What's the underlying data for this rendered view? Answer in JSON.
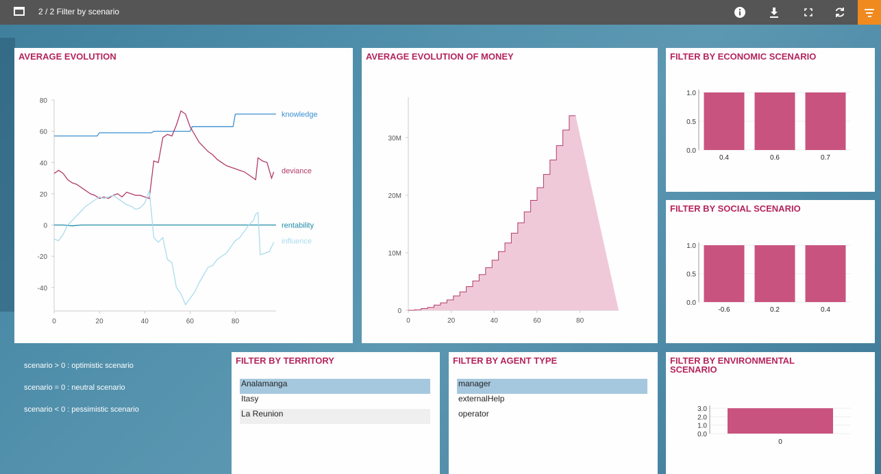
{
  "window": {
    "title": "2 / 2 Filter by scenario"
  },
  "toolbar": {
    "info_icon": "info-icon",
    "download_icon": "download-icon",
    "fullscreen_icon": "fullscreen-icon",
    "refresh_icon": "refresh-icon",
    "filter_icon": "filter-icon",
    "filter_color": "#f08a1e"
  },
  "colors": {
    "title": "#b4245c",
    "bar": "#c9537f",
    "knowledge": "#3a8fd0",
    "deviance": "#b13a69",
    "rentability": "#1f8aa8",
    "influence": "#a9dbee",
    "money_line": "#b13a69",
    "money_fill": "#f0c9d9"
  },
  "panels": {
    "avg_evolution": {
      "title": "AVERAGE EVOLUTION"
    },
    "avg_money": {
      "title": "AVERAGE EVOLUTION OF MONEY"
    },
    "economic": {
      "title": "FILTER BY ECONOMIC SCENARIO"
    },
    "social": {
      "title": "FILTER BY SOCIAL SCENARIO"
    },
    "territory": {
      "title": "FILTER BY TERRITORY"
    },
    "agent_type": {
      "title": "FILTER BY AGENT TYPE"
    },
    "environmental": {
      "title": "FILTER BY ENVIRONMENTAL SCENARIO"
    }
  },
  "legend": {
    "optimistic": "scenario > 0 : optimistic scenario",
    "neutral": "scenario = 0 : neutral scenario",
    "pessimistic": "scenario < 0 : pessimistic scenario"
  },
  "territory": {
    "items": [
      "Analamanga",
      "Itasy",
      "La Reunion"
    ],
    "selected": "Analamanga"
  },
  "agent_type": {
    "items": [
      "manager",
      "externalHelp",
      "operator"
    ],
    "selected": "manager"
  },
  "chart_data": [
    {
      "type": "line",
      "title": "AVERAGE EVOLUTION",
      "xlim": [
        0,
        98
      ],
      "ylim": [
        -55,
        80
      ],
      "xticks": [
        0,
        20,
        40,
        60,
        80
      ],
      "yticks": [
        80,
        60,
        40,
        20,
        0,
        -20,
        -40
      ],
      "series": [
        {
          "name": "knowledge",
          "points": [
            [
              0,
              57
            ],
            [
              19,
              57
            ],
            [
              20,
              59
            ],
            [
              43,
              59
            ],
            [
              44,
              60
            ],
            [
              60,
              60
            ],
            [
              61,
              63
            ],
            [
              79,
              63
            ],
            [
              80,
              71
            ],
            [
              98,
              71
            ]
          ]
        },
        {
          "name": "deviance",
          "points": [
            [
              0,
              33
            ],
            [
              2,
              35
            ],
            [
              4,
              33
            ],
            [
              6,
              29
            ],
            [
              8,
              27
            ],
            [
              10,
              26
            ],
            [
              12,
              24
            ],
            [
              14,
              22
            ],
            [
              16,
              20
            ],
            [
              18,
              19
            ],
            [
              20,
              17
            ],
            [
              22,
              18
            ],
            [
              24,
              17
            ],
            [
              26,
              19
            ],
            [
              28,
              20
            ],
            [
              30,
              18
            ],
            [
              32,
              21
            ],
            [
              34,
              20
            ],
            [
              36,
              19
            ],
            [
              38,
              19
            ],
            [
              40,
              18
            ],
            [
              42,
              17
            ],
            [
              44,
              41
            ],
            [
              46,
              40
            ],
            [
              48,
              56
            ],
            [
              50,
              58
            ],
            [
              52,
              57
            ],
            [
              54,
              64
            ],
            [
              56,
              73
            ],
            [
              58,
              71
            ],
            [
              60,
              63
            ],
            [
              62,
              58
            ],
            [
              64,
              53
            ],
            [
              66,
              50
            ],
            [
              68,
              47
            ],
            [
              70,
              45
            ],
            [
              72,
              42
            ],
            [
              74,
              40
            ],
            [
              76,
              38
            ],
            [
              78,
              37
            ],
            [
              80,
              36
            ],
            [
              82,
              35
            ],
            [
              84,
              34
            ],
            [
              86,
              32
            ],
            [
              88,
              30
            ],
            [
              89,
              29
            ],
            [
              90,
              43
            ],
            [
              92,
              41
            ],
            [
              94,
              40
            ],
            [
              95,
              35
            ],
            [
              96,
              30
            ],
            [
              97,
              34
            ]
          ]
        },
        {
          "name": "rentability",
          "points": [
            [
              0,
              0
            ],
            [
              4,
              0
            ],
            [
              8,
              -0.5
            ],
            [
              12,
              0
            ],
            [
              16,
              0
            ],
            [
              24,
              0
            ],
            [
              40,
              0
            ],
            [
              60,
              0
            ],
            [
              80,
              0
            ],
            [
              98,
              0
            ]
          ]
        },
        {
          "name": "influence",
          "points": [
            [
              0,
              -9
            ],
            [
              2,
              -10
            ],
            [
              4,
              -6
            ],
            [
              6,
              0
            ],
            [
              8,
              3
            ],
            [
              10,
              6
            ],
            [
              12,
              9
            ],
            [
              14,
              12
            ],
            [
              16,
              14
            ],
            [
              18,
              16
            ],
            [
              20,
              18
            ],
            [
              22,
              17
            ],
            [
              24,
              18
            ],
            [
              26,
              19
            ],
            [
              28,
              17
            ],
            [
              30,
              15
            ],
            [
              32,
              13
            ],
            [
              34,
              12
            ],
            [
              36,
              10
            ],
            [
              38,
              11
            ],
            [
              40,
              14
            ],
            [
              42,
              22
            ],
            [
              44,
              -8
            ],
            [
              46,
              -11
            ],
            [
              48,
              -8
            ],
            [
              50,
              -22
            ],
            [
              52,
              -24
            ],
            [
              54,
              -40
            ],
            [
              56,
              -44
            ],
            [
              58,
              -51
            ],
            [
              60,
              -47
            ],
            [
              62,
              -43
            ],
            [
              64,
              -37
            ],
            [
              66,
              -32
            ],
            [
              68,
              -27
            ],
            [
              70,
              -26
            ],
            [
              72,
              -22
            ],
            [
              74,
              -20
            ],
            [
              76,
              -18
            ],
            [
              78,
              -14
            ],
            [
              80,
              -10
            ],
            [
              82,
              -8
            ],
            [
              84,
              -4
            ],
            [
              86,
              0
            ],
            [
              88,
              3
            ],
            [
              89,
              7
            ],
            [
              90,
              8
            ],
            [
              91,
              -19
            ],
            [
              93,
              -18
            ],
            [
              95,
              -17
            ],
            [
              96,
              -14
            ],
            [
              97,
              -11
            ]
          ]
        }
      ]
    },
    {
      "type": "area",
      "title": "AVERAGE EVOLUTION OF MONEY",
      "xlim": [
        0,
        98
      ],
      "ylim": [
        0,
        37000000
      ],
      "xticks": [
        0,
        20,
        40,
        60,
        80
      ],
      "yticks": [
        0,
        10000000,
        20000000,
        30000000
      ],
      "ytick_labels": [
        "0",
        "10M",
        "20M",
        "30M"
      ],
      "step": 3,
      "values_millions": [
        0,
        0.1,
        0.3,
        0.5,
        0.9,
        1.3,
        1.8,
        2.5,
        3.2,
        4.1,
        5.1,
        6.2,
        7.4,
        8.7,
        10.2,
        11.7,
        13.4,
        15.2,
        17.1,
        19.1,
        21.3,
        23.6,
        26.1,
        28.6,
        31.3,
        33.8
      ]
    },
    {
      "type": "bar",
      "title": "FILTER BY ECONOMIC SCENARIO",
      "categories": [
        "0.4",
        "0.6",
        "0.7"
      ],
      "values": [
        1,
        1,
        1
      ],
      "ylim": [
        0,
        1
      ],
      "yticks": [
        "1.0",
        "0.5",
        "0.0"
      ]
    },
    {
      "type": "bar",
      "title": "FILTER BY SOCIAL SCENARIO",
      "categories": [
        "-0.6",
        "0.2",
        "0.4"
      ],
      "values": [
        1,
        1,
        1
      ],
      "ylim": [
        0,
        1
      ],
      "yticks": [
        "1.0",
        "0.5",
        "0.0"
      ]
    },
    {
      "type": "bar",
      "title": "FILTER BY ENVIRONMENTAL SCENARIO",
      "categories": [
        "0"
      ],
      "values": [
        3
      ],
      "ylim": [
        0,
        3
      ],
      "yticks": [
        "3.0",
        "2.0",
        "1.0",
        "0.0"
      ]
    }
  ]
}
